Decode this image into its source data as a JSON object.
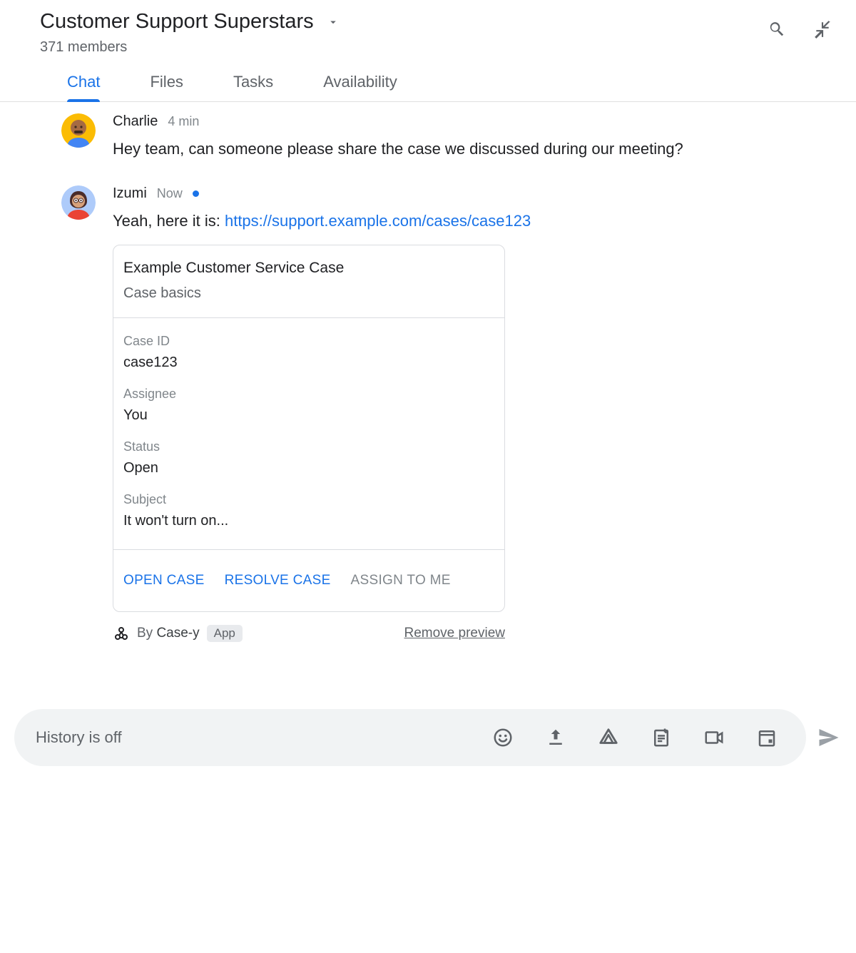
{
  "header": {
    "title": "Customer Support Superstars",
    "members": "371 members"
  },
  "tabs": [
    {
      "label": "Chat",
      "active": true
    },
    {
      "label": "Files",
      "active": false
    },
    {
      "label": "Tasks",
      "active": false
    },
    {
      "label": "Availability",
      "active": false
    }
  ],
  "messages": [
    {
      "sender": "Charlie",
      "time": "4 min",
      "text": "Hey team, can someone please share the case we discussed during our meeting?",
      "avatar": "charlie"
    },
    {
      "sender": "Izumi",
      "time": "Now",
      "now_dot": true,
      "text_prefix": "Yeah, here it is: ",
      "link_text": "https://support.example.com/cases/case123",
      "avatar": "izumi",
      "card": {
        "title": "Example Customer Service Case",
        "subtitle": "Case basics",
        "fields": [
          {
            "label": "Case ID",
            "value": "case123"
          },
          {
            "label": "Assignee",
            "value": "You"
          },
          {
            "label": "Status",
            "value": "Open"
          },
          {
            "label": "Subject",
            "value": "It won't turn on..."
          }
        ],
        "actions": [
          {
            "label": "OPEN CASE",
            "style": "primary"
          },
          {
            "label": "RESOLVE CASE",
            "style": "primary"
          },
          {
            "label": "ASSIGN TO ME",
            "style": "disabled"
          }
        ],
        "footer": {
          "by_prefix": "By ",
          "by_name": "Case-y",
          "badge": "App",
          "remove": "Remove preview"
        }
      }
    }
  ],
  "composer": {
    "placeholder": "History is off"
  }
}
